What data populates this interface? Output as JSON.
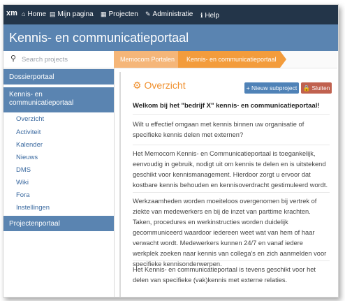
{
  "topnav": {
    "logo": "xm",
    "items": [
      {
        "label": "Home",
        "icon": "home-icon"
      },
      {
        "label": "Mijn pagina",
        "icon": "page-icon"
      },
      {
        "label": "Projecten",
        "icon": "projects-icon"
      },
      {
        "label": "Administratie",
        "icon": "wrench-icon"
      },
      {
        "label": "Help",
        "icon": "info-icon"
      }
    ]
  },
  "header": {
    "title": "Kennis- en communicatieportaal"
  },
  "sidebar": {
    "search_placeholder": "Search projects",
    "sections": [
      {
        "label": "Dossierportaal"
      },
      {
        "label": "Kennis- en communicatieportaal"
      },
      {
        "label": "Projectenportaal"
      }
    ],
    "items": [
      "Overzicht",
      "Activiteit",
      "Kalender",
      "Nieuws",
      "DMS",
      "Wiki",
      "Fora",
      "Instellingen"
    ]
  },
  "breadcrumbs": [
    "Memocom Portalen",
    "Kennis- en communicatieportaal"
  ],
  "main": {
    "title": "Overzicht",
    "title_icon": "dashboard-icon",
    "new_button": "+ Nieuw subproject",
    "close_button": "🔒 Sluiten",
    "heading": "Welkom bij het \"bedrijf X\" kennis- en communicatieportaal!",
    "paragraphs": [
      "Wilt u effectief omgaan met kennis binnen uw organisatie of specifieke kennis delen met externen?",
      "Het Memocom Kennis- en Communicatieportaal is toegankelijk, eenvoudig in gebruik, nodigt uit om kennis te delen en is uitstekend geschikt voor kennismanagement. Hierdoor zorgt u ervoor dat kostbare kennis behouden en kennisoverdracht gestimuleerd wordt.",
      "Werkzaamheden worden moeiteloos overgenomen bij vertrek of ziekte van medewerkers en bij de inzet van parttime krachten. Taken, procedures en werkinstructies worden duidelijk gecommuniceerd waardoor iedereen weet wat van hem of haar verwacht wordt. Medewerkers kunnen 24/7 en vanaf iedere werkplek zoeken naar kennis van collega's en zich aanmelden voor specifieke kennisonderwerpen.",
      "Het Kennis- en communicatieportaal is tevens geschikt voor het delen van specifieke (vak)kennis met externe relaties."
    ]
  },
  "colors": {
    "topnav": "#233549",
    "accent_blue": "#5a84b1",
    "crumb_light": "#f5b679",
    "crumb_active": "#f39c3c",
    "title_orange": "#f0902e"
  }
}
